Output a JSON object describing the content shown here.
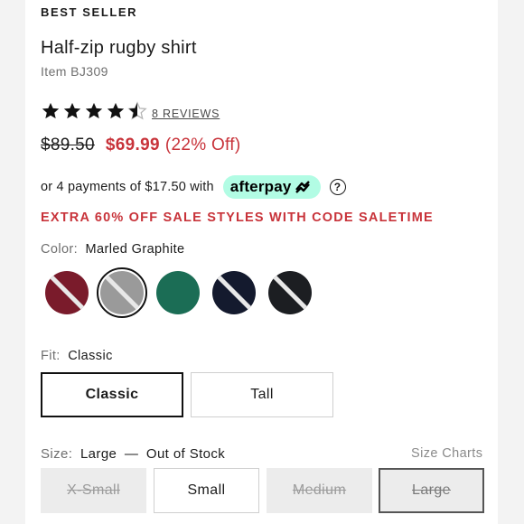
{
  "product": {
    "badge": "BEST SELLER",
    "title": "Half-zip rugby shirt",
    "item_number": "Item BJ309",
    "rating": 4.5,
    "rating_max": 5,
    "reviews_label": "8 REVIEWS"
  },
  "pricing": {
    "original": "$89.50",
    "sale": "$69.99",
    "discount": "(22% Off)"
  },
  "payment": {
    "text": "or 4 payments of $17.50 with",
    "provider": "afterpay",
    "help_icon": "question-circle-icon"
  },
  "promo": "EXTRA 60% OFF SALE STYLES WITH CODE SALETIME",
  "color": {
    "label": "Color:",
    "selected": "Marled Graphite",
    "swatches": [
      {
        "name": "burgundy",
        "hex": "#7a1b2b",
        "available": false
      },
      {
        "name": "marled-graphite",
        "hex": "#9a9a9a",
        "available": false,
        "selected": true
      },
      {
        "name": "green",
        "hex": "#1b6d55",
        "available": true
      },
      {
        "name": "navy",
        "hex": "#141a2e",
        "available": false
      },
      {
        "name": "black",
        "hex": "#1c1e22",
        "available": false
      }
    ]
  },
  "fit": {
    "label": "Fit:",
    "selected": "Classic",
    "options": [
      "Classic",
      "Tall"
    ]
  },
  "size": {
    "label": "Size:",
    "selected": "Large",
    "separator": "—",
    "status": "Out of Stock",
    "charts_link": "Size Charts",
    "options": [
      {
        "label": "X-Small",
        "available": false
      },
      {
        "label": "Small",
        "available": true
      },
      {
        "label": "Medium",
        "available": false
      },
      {
        "label": "Large",
        "available": false,
        "selected": true
      }
    ]
  },
  "colors": {
    "sale_red": "#c8333a",
    "afterpay_mint": "#b2fce4"
  }
}
